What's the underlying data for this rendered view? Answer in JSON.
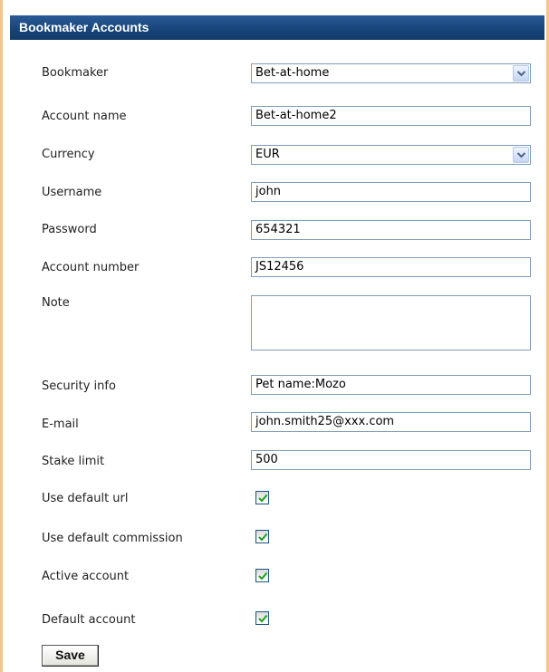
{
  "header": {
    "title": "Bookmaker Accounts"
  },
  "form": {
    "bookmaker": {
      "label": "Bookmaker",
      "value": "Bet-at-home"
    },
    "account_name": {
      "label": "Account name",
      "value": "Bet-at-home2"
    },
    "currency": {
      "label": "Currency",
      "value": "EUR"
    },
    "username": {
      "label": "Username",
      "value": "john"
    },
    "password": {
      "label": "Password",
      "value": "654321"
    },
    "account_number": {
      "label": "Account number",
      "value": "JS12456"
    },
    "note": {
      "label": "Note",
      "value": ""
    },
    "security_info": {
      "label": "Security info",
      "value": "Pet name:Mozo"
    },
    "email": {
      "label": "E-mail",
      "value": "john.smith25@xxx.com"
    },
    "stake_limit": {
      "label": "Stake limit",
      "value": "500"
    },
    "use_default_url": {
      "label": "Use default url",
      "checked": true
    },
    "use_default_commission": {
      "label": "Use default commission",
      "checked": true
    },
    "active_account": {
      "label": "Active account",
      "checked": true
    },
    "default_account": {
      "label": "Default account",
      "checked": true
    }
  },
  "actions": {
    "save_label": "Save"
  },
  "colors": {
    "header_bg": "#174478",
    "panel_border": "#f7c48a",
    "input_border": "#7f9db9",
    "checkmark": "#21a121"
  }
}
